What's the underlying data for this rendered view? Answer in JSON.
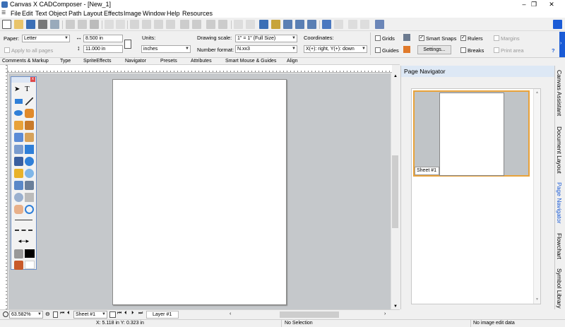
{
  "window": {
    "title": "Canvas X CADComposer - [New_1]",
    "minimize": "–",
    "restore": "❐",
    "close": "✕"
  },
  "menu": [
    "File",
    "Edit",
    "Text",
    "Object",
    "Path",
    "Layout",
    "Effects",
    "Image",
    "Window",
    "Help",
    "Resources"
  ],
  "props": {
    "paper_label": "Paper:",
    "paper_value": "Letter",
    "width_value": "8.500 in",
    "height_value": "11.000 in",
    "apply_all_label": "Apply to all pages",
    "units_label": "Units:",
    "units_value": "inches",
    "drawing_scale_label": "Drawing scale:",
    "drawing_scale_value": "1\" = 1\" (Full Size)",
    "number_format_label": "Number format:",
    "number_format_value": "N.xx3",
    "coordinates_label": "Coordinates:",
    "coordinates_value": "X(+): right, Y(+): down",
    "grids_label": "Grids",
    "guides_label": "Guides",
    "smart_snaps_label": "Smart Snaps",
    "settings_label": "Settings...",
    "rulers_label": "Rulers",
    "breaks_label": "Breaks",
    "margins_label": "Margins",
    "print_area_label": "Print area",
    "help": "?"
  },
  "tabs": [
    "Comments & Markup",
    "Type",
    "SpriteEffects",
    "Navigator",
    "Presets",
    "Attributes",
    "Smart Mouse & Guides",
    "Align"
  ],
  "bottom": {
    "zoom": "63.582%",
    "sheet": "Sheet #1",
    "layer": "Layer #1"
  },
  "status": {
    "coords": "X: 5.118 in Y: 0.323 in",
    "selection": "No Selection",
    "image": "No image edit data"
  },
  "nav": {
    "title": "Page Navigator",
    "sheet_label": "Sheet #1"
  },
  "side_tabs": [
    "Canvas Assistant",
    "Document Layout",
    "Page Navigator",
    "Flowchart",
    "Symbol Library"
  ]
}
